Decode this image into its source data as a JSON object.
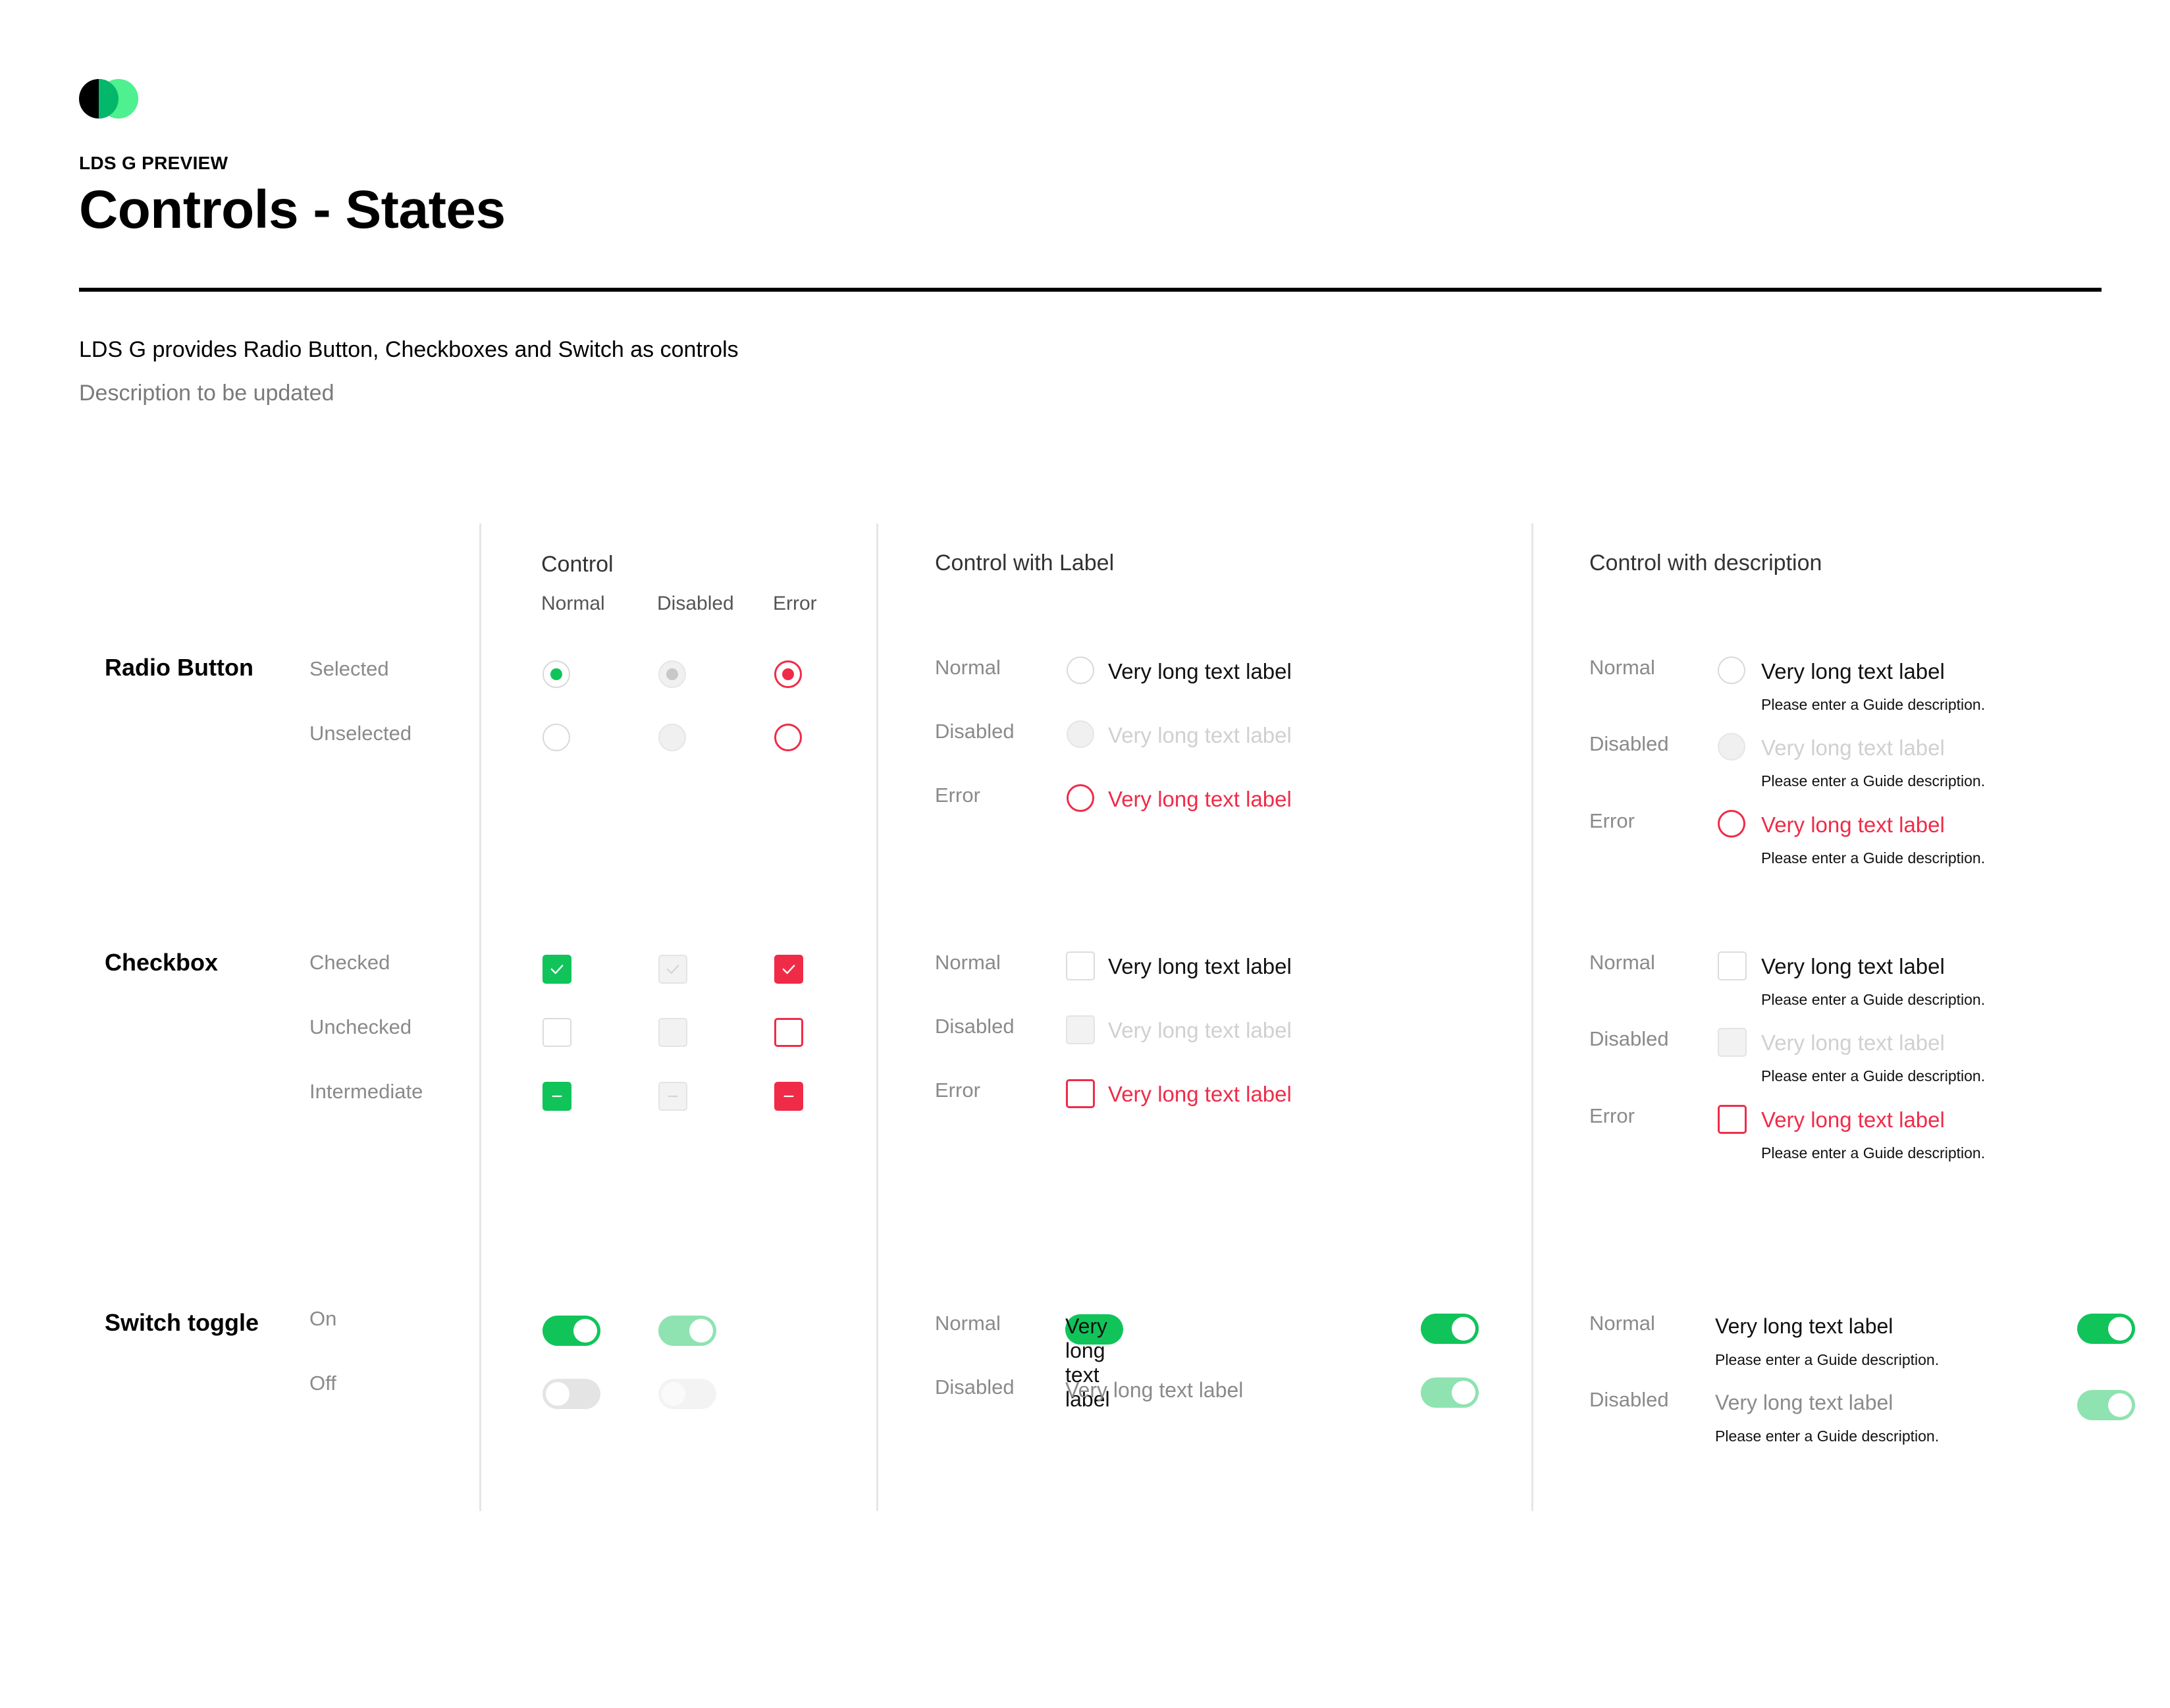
{
  "header": {
    "eyebrow": "LDS G PREVIEW",
    "title": "Controls - States",
    "intro": "LDS G provides Radio Button, Checkboxes and Switch as controls",
    "description": "Description to be updated"
  },
  "columns": {
    "control": "Control",
    "normal": "Normal",
    "disabled": "Disabled",
    "error": "Error",
    "with_label": "Control with Label",
    "with_description": "Control with description"
  },
  "rows": {
    "radio": "Radio Button",
    "checkbox": "Checkbox",
    "switch": "Switch toggle"
  },
  "states": {
    "selected": "Selected",
    "unselected": "Unselected",
    "checked": "Checked",
    "unchecked": "Unchecked",
    "intermediate": "Intermediate",
    "on": "On",
    "off": "Off",
    "normal": "Normal",
    "disabled": "Disabled",
    "error": "Error"
  },
  "label_text": "Very long text label",
  "guide_text": "Please enter a Guide description.",
  "colors": {
    "accent": "#10c45a",
    "error": "#f02b48",
    "disabled": "#d0d0d0",
    "logo_dark": "#000000",
    "logo_green": "#4ef08f"
  }
}
